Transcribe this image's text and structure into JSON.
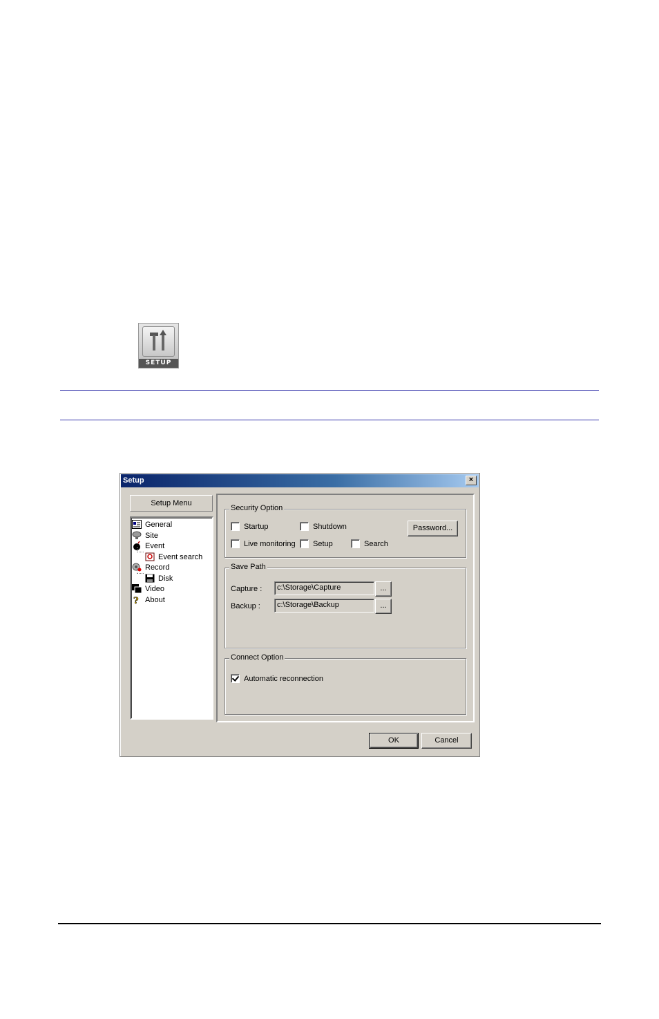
{
  "page": {
    "setup_button_caption": "SETUP"
  },
  "dialog": {
    "title": "Setup",
    "close_glyph": "×",
    "setup_menu_label": "Setup Menu",
    "tree": [
      {
        "label": "General",
        "icon": "general-icon"
      },
      {
        "label": "Site",
        "icon": "site-icon"
      },
      {
        "label": "Event",
        "icon": "event-icon"
      },
      {
        "label": "Event search",
        "icon": "event-search-icon"
      },
      {
        "label": "Record",
        "icon": "record-icon"
      },
      {
        "label": "Disk",
        "icon": "disk-icon"
      },
      {
        "label": "Video",
        "icon": "video-icon"
      },
      {
        "label": "About",
        "icon": "about-icon"
      }
    ],
    "security": {
      "title": "Security Option",
      "startup": {
        "label": "Startup",
        "checked": false
      },
      "shutdown": {
        "label": "Shutdown",
        "checked": false
      },
      "live": {
        "label": "Live monitoring",
        "checked": false
      },
      "setup": {
        "label": "Setup",
        "checked": false
      },
      "search": {
        "label": "Search",
        "checked": false
      },
      "password_label": "Password..."
    },
    "save_path": {
      "title": "Save Path",
      "capture_label": "Capture :",
      "capture_value": "c:\\Storage\\Capture",
      "backup_label": "Backup :",
      "backup_value": "c:\\Storage\\Backup",
      "browse_label": "..."
    },
    "connect": {
      "title": "Connect Option",
      "auto_reconnect": {
        "label": "Automatic reconnection",
        "checked": true
      }
    },
    "ok_label": "OK",
    "cancel_label": "Cancel"
  }
}
